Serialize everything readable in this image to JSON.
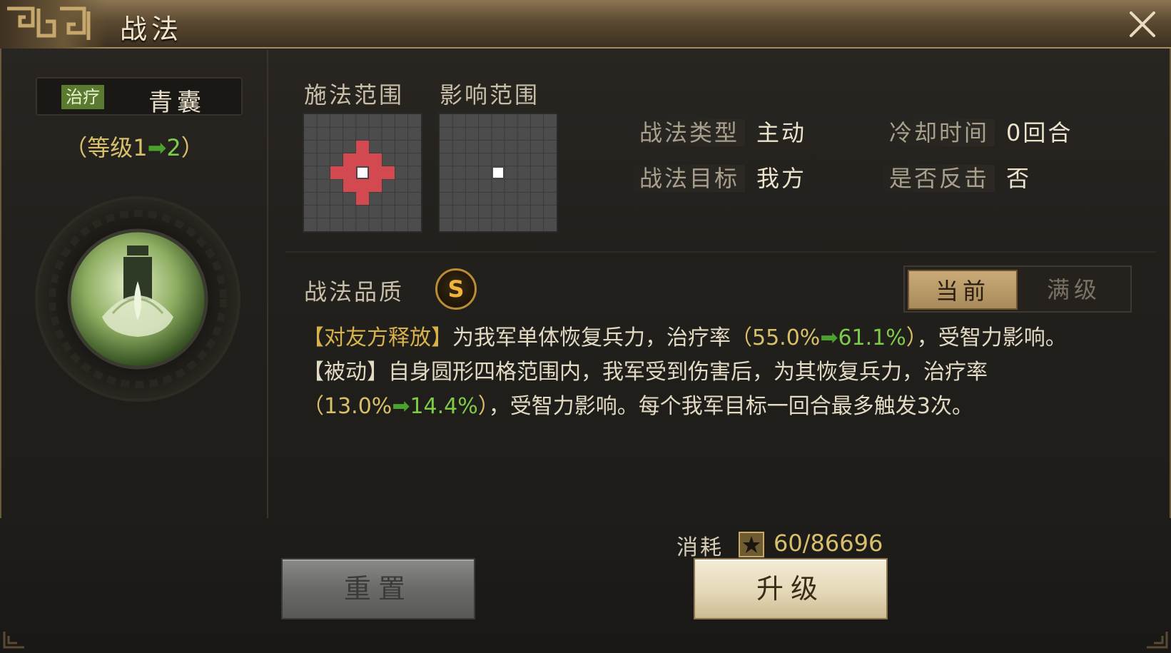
{
  "window": {
    "title": "战法"
  },
  "skill": {
    "type_tag": "治疗",
    "name": "青囊",
    "level": {
      "open": "（等级",
      "from": "1",
      "to": "2",
      "close": "）"
    }
  },
  "ranges": {
    "cast_label": "施法范围",
    "effect_label": "影响范围"
  },
  "stats": {
    "type_key": "战法类型",
    "type_value": "主动",
    "cooldown_key": "冷却时间",
    "cooldown_value": "0回合",
    "target_key": "战法目标",
    "target_value": "我方",
    "counter_key": "是否反击",
    "counter_value": "否"
  },
  "quality": {
    "label": "战法品质",
    "grade": "S"
  },
  "toggle": {
    "current": "当前",
    "max": "满级"
  },
  "description": {
    "p1_tag": "【对友方释放】",
    "p1_text": "为我军单体恢复兵力，治疗率",
    "p1_paren_open": "（",
    "p1_from": "55.0%",
    "p1_to": "61.1%",
    "p1_paren_close": "）",
    "p1_tail": "，受智力影响。",
    "p2_tag": "【被动】",
    "p2_text": "自身圆形四格范围内，我军受到伤害后，为其恢复兵力，治疗率",
    "p2_paren_open": "（",
    "p2_from": "13.0%",
    "p2_to": "14.4%",
    "p2_paren_close": "）",
    "p2_tail": "，受智力影响。每个我军目标一回合最多触发3次。"
  },
  "cost": {
    "label": "消耗",
    "value": "60/86696"
  },
  "buttons": {
    "reset": "重置",
    "upgrade": "升级"
  },
  "colors": {
    "accent_gold": "#d8c06a",
    "green": "#7ecb4a",
    "heal_tag": "#5a7a2f",
    "range_red": "#d24a4f"
  }
}
